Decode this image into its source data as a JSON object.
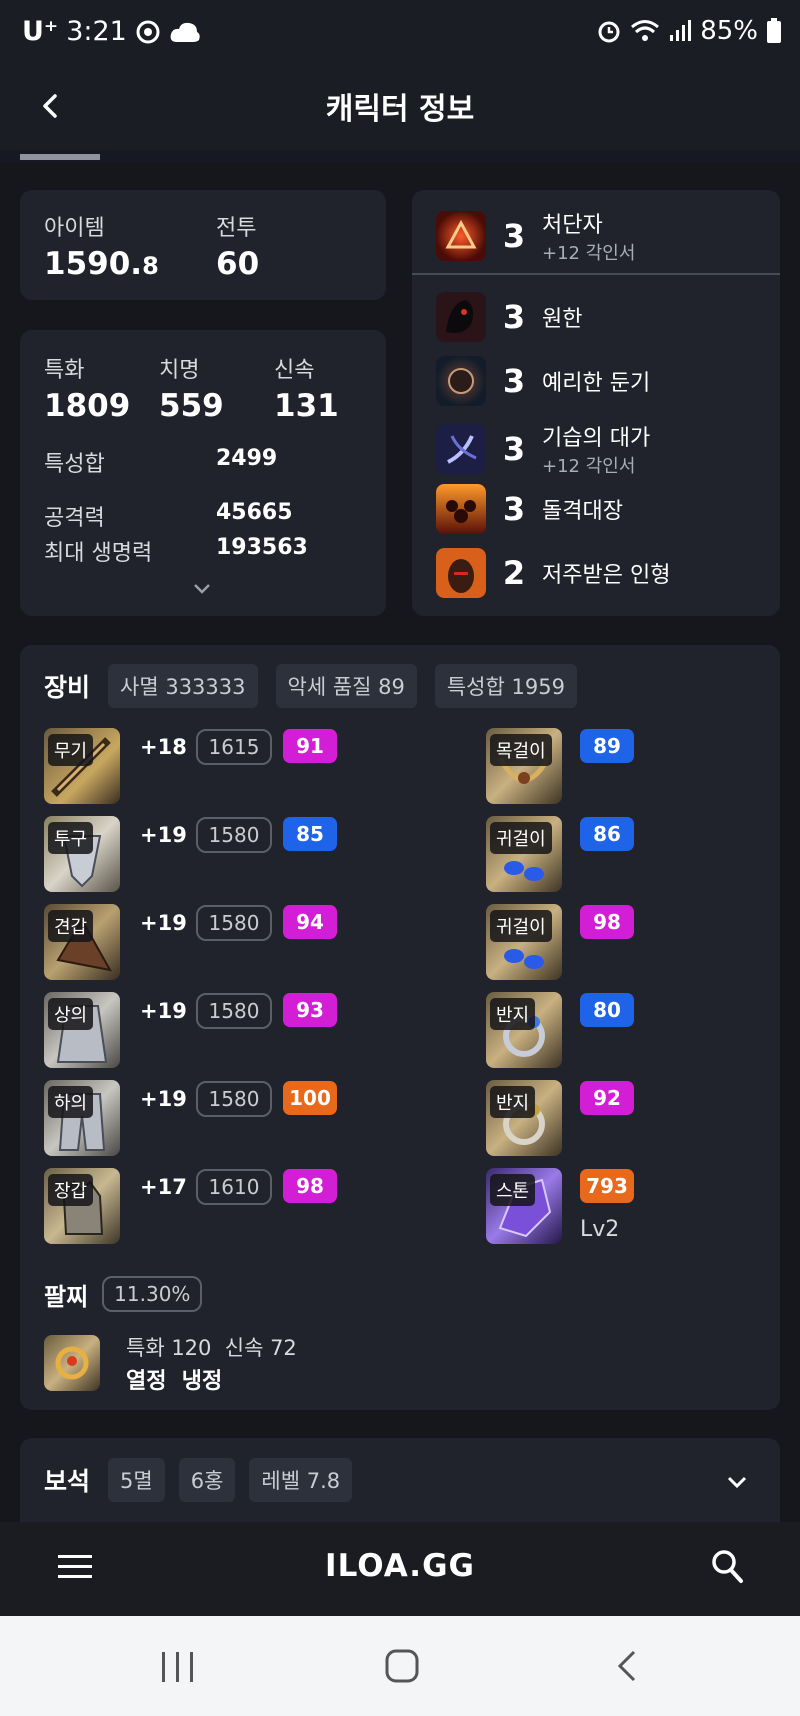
{
  "status_bar": {
    "carrier": "U⁺",
    "time": "3:21",
    "battery": "85%"
  },
  "header": {
    "title": "캐릭터 정보"
  },
  "summary": {
    "item_level_label": "아이템",
    "item_level_int": "1590.",
    "item_level_dec": "8",
    "combat_label": "전투",
    "combat_value": "60"
  },
  "stats": {
    "spec_label": "특화",
    "spec_value": "1809",
    "crit_label": "치명",
    "crit_value": "559",
    "swift_label": "신속",
    "swift_value": "131",
    "total_label": "특성합",
    "total_value": "2499",
    "atk_label": "공격력",
    "atk_value": "45665",
    "hp_label": "최대 생명력",
    "hp_value": "193563"
  },
  "engravings": [
    {
      "level": "3",
      "name": "처단자",
      "sub": "+12 각인서"
    },
    {
      "level": "3",
      "name": "원한",
      "sub": ""
    },
    {
      "level": "3",
      "name": "예리한 둔기",
      "sub": ""
    },
    {
      "level": "3",
      "name": "기습의 대가",
      "sub": "+12 각인서"
    },
    {
      "level": "3",
      "name": "돌격대장",
      "sub": ""
    },
    {
      "level": "2",
      "name": "저주받은 인형",
      "sub": ""
    }
  ],
  "equipment": {
    "title": "장비",
    "chips": [
      "사멸 333333",
      "악세 품질 89",
      "특성합 1959"
    ],
    "armor": [
      {
        "slot": "무기",
        "plus": "+18",
        "ilvl": "1615",
        "quality": "91"
      },
      {
        "slot": "투구",
        "plus": "+19",
        "ilvl": "1580",
        "quality": "85"
      },
      {
        "slot": "견갑",
        "plus": "+19",
        "ilvl": "1580",
        "quality": "94"
      },
      {
        "slot": "상의",
        "plus": "+19",
        "ilvl": "1580",
        "quality": "93"
      },
      {
        "slot": "하의",
        "plus": "+19",
        "ilvl": "1580",
        "quality": "100"
      },
      {
        "slot": "장갑",
        "plus": "+17",
        "ilvl": "1610",
        "quality": "98"
      }
    ],
    "accessories": [
      {
        "slot": "목걸이",
        "quality": "89"
      },
      {
        "slot": "귀걸이",
        "quality": "86"
      },
      {
        "slot": "귀걸이",
        "quality": "98"
      },
      {
        "slot": "반지",
        "quality": "80"
      },
      {
        "slot": "반지",
        "quality": "92"
      },
      {
        "slot": "스톤",
        "quality": "793",
        "extra": "Lv2"
      }
    ],
    "bracelet_label": "팔찌",
    "bracelet_percent": "11.30%",
    "bracelet_stats": "특화 120  신속 72",
    "bracelet_effects": "열정  냉정"
  },
  "gems": {
    "title": "보석",
    "chips": [
      "5멸",
      "6홍",
      "레벨 7.8"
    ]
  },
  "bottom_nav": {
    "logo": "ILOA.GG"
  },
  "colors": {
    "pink": "#d21fd6",
    "blue": "#1f63e8",
    "orange": "#e8691b"
  }
}
